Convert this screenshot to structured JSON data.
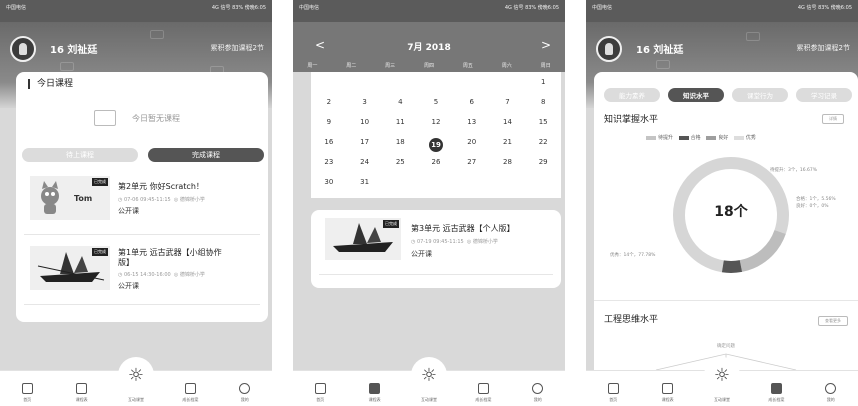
{
  "status": {
    "carrier": "中国电信",
    "right": "4G 信号 83% 傍晚6:05"
  },
  "user": {
    "name": "16 刘祉廷",
    "accum": "累积参加课程2节"
  },
  "home": {
    "section_title": "今日课程",
    "empty_text": "今日暂无课程",
    "tab_pending": "待上课程",
    "tab_done": "完成课程",
    "courses": [
      {
        "badge": "已完成",
        "title": "第2单元 你好Scratch！",
        "time": "07-06 09:45-11:15",
        "place": "德锦桥小学",
        "type": "公开课",
        "thumb_text": "Tom"
      },
      {
        "badge": "已完成",
        "title_l1": "第1单元 远古武器【小组协作",
        "title_l2": "版】",
        "time": "06-15 14:30-16:00",
        "place": "德锦桥小学",
        "type": "公开课"
      }
    ]
  },
  "calendar": {
    "month": "7月 2018",
    "prev": "<",
    "next": ">",
    "weekdays": [
      "周一",
      "周二",
      "周三",
      "周四",
      "周五",
      "周六",
      "周日"
    ],
    "rows": [
      [
        "",
        "",
        "",
        "",
        "",
        "",
        "1"
      ],
      [
        "2",
        "3",
        "4",
        "5",
        "6",
        "7",
        "8"
      ],
      [
        "9",
        "10",
        "11",
        "12",
        "13",
        "14",
        "15"
      ],
      [
        "16",
        "17",
        "18",
        "19",
        "20",
        "21",
        "22"
      ],
      [
        "23",
        "24",
        "25",
        "26",
        "27",
        "28",
        "29"
      ],
      [
        "30",
        "31",
        "",
        "",
        "",
        "",
        ""
      ]
    ],
    "today": "19",
    "course": {
      "badge": "已完成",
      "title": "第3单元 远古武器【个人版】",
      "time": "07-19 09:45-11:15",
      "place": "德锦桥小学",
      "type": "公开课"
    }
  },
  "stats": {
    "tabs": [
      "能力素养",
      "知识水平",
      "课堂行为",
      "学习记录"
    ],
    "active_tab": "知识水平",
    "knowledge_title": "知识掌握水平",
    "detail_btn": "详情",
    "legend": [
      {
        "label": "待提升",
        "color": "#c4c4c4"
      },
      {
        "label": "合格",
        "color": "#555555"
      },
      {
        "label": "良好",
        "color": "#9e9e9e"
      },
      {
        "label": "优秀",
        "color": "#dddddd"
      }
    ],
    "center": "18个",
    "callouts": {
      "improve": "待提升：3个，16.67%",
      "pass": "合格：1个，5.56%",
      "good": "良好：0个，0%",
      "excellent": "优秀：14个，77.78%"
    },
    "eng_title": "工程思维水平",
    "eng_btn": "查看更多",
    "radar_top": "确定问题"
  },
  "nav": {
    "items": [
      "首页",
      "课程表",
      "互动课堂",
      "成长档案",
      "我的"
    ]
  },
  "colors": {
    "accent": "#555555",
    "page": "#d9d9d9"
  }
}
